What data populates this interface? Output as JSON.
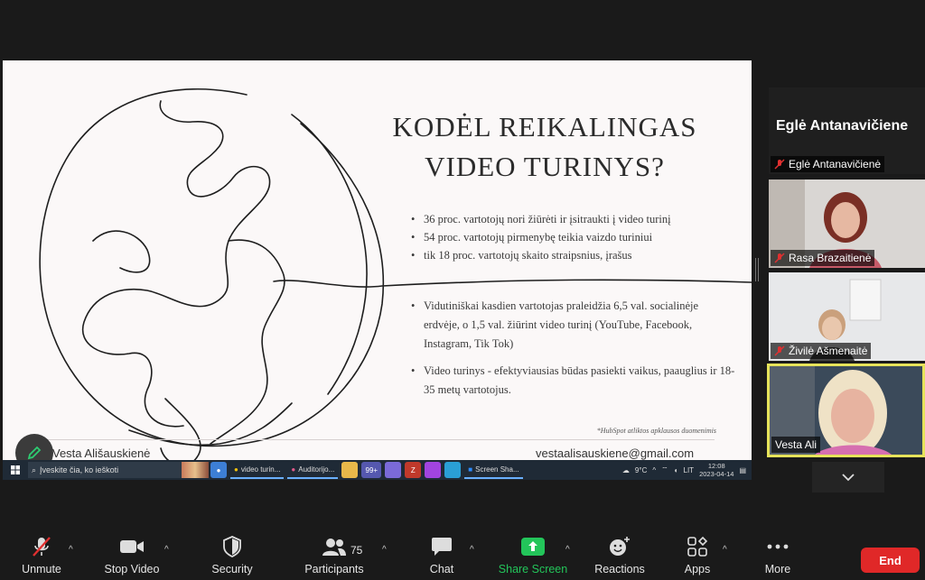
{
  "slide": {
    "title_line1": "KODĖL REIKALINGAS",
    "title_line2": "VIDEO TURINYS?",
    "bullets_top": [
      "36 proc. vartotojų nori žiūrėti ir įsitraukti į video turinį",
      "54 proc. vartotojų pirmenybę teikia vaizdo turiniui",
      "tik 18 proc. vartotojų skaito straipsnius, įrašus"
    ],
    "bullets_bottom": [
      "Vidutiniškai kasdien vartotojas praleidžia 6,5 val. socialinėje erdvėje, o 1,5 val. žiūrint video turinį (YouTube, Facebook, Instagram, Tik Tok)",
      "Video turinys - efektyviausias būdas pasiekti vaikus, paauglius ir 18-35 metų vartotojus."
    ],
    "footnote": "*HubSpot atliktos apklausos duomenimis",
    "presenter_name": "Vesta Ališauskienė",
    "presenter_email": "vestaalisauskiene@gmail.com"
  },
  "taskbar": {
    "search_placeholder": "Įveskite čia, ko ieškoti",
    "apps": [
      "video turin...",
      "Auditorijo...",
      "Screen Sha..."
    ],
    "badge": "99+",
    "weather": "9°C",
    "lang": "LIT",
    "time": "12:08",
    "date": "2023-04-14"
  },
  "participants": {
    "active_speaker_big": "Eglė  Antanavičiene",
    "tiles": [
      {
        "name": "Eglė Antanavičienė",
        "muted": true
      },
      {
        "name": "Rasa Brazaitienė",
        "muted": true
      },
      {
        "name": "Živilė Ašmenaitė",
        "muted": true
      },
      {
        "name": "Vesta Ali",
        "muted": false
      }
    ]
  },
  "toolbar": {
    "unmute": "Unmute",
    "stop_video": "Stop Video",
    "security": "Security",
    "participants": "Participants",
    "participants_count": "75",
    "chat": "Chat",
    "share_screen": "Share Screen",
    "reactions": "Reactions",
    "apps": "Apps",
    "more": "More",
    "end": "End"
  },
  "colors": {
    "share_green": "#23c55a",
    "end_red": "#e02828",
    "active_border": "#e6e35a"
  }
}
